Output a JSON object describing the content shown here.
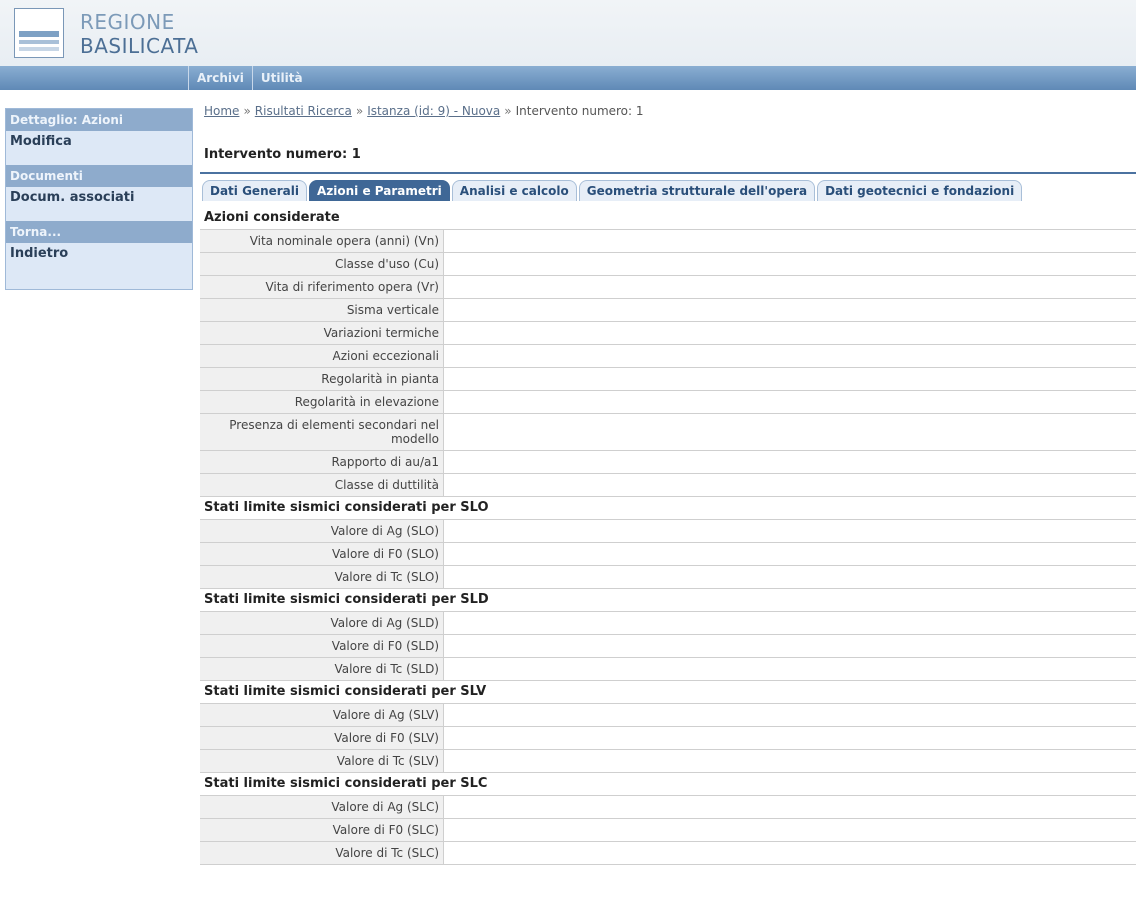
{
  "header": {
    "region_line1": "REGIONE",
    "region_line2": "BASILICATA"
  },
  "nav": {
    "items": [
      "Archivi",
      "Utilità"
    ]
  },
  "sidebar": {
    "sections": [
      {
        "title": "Dettaglio: Azioni",
        "items": [
          "Modifica"
        ]
      },
      {
        "title": "Documenti",
        "items": [
          "Docum. associati"
        ]
      },
      {
        "title": "Torna...",
        "items": [
          "Indietro"
        ]
      }
    ]
  },
  "breadcrumb": {
    "home": "Home",
    "results": "Risultati Ricerca",
    "instance": "Istanza (id: 9) - Nuova",
    "current": "Intervento numero: 1",
    "separator": "»"
  },
  "page": {
    "title": "Intervento numero: 1"
  },
  "tabs": [
    {
      "label": "Dati Generali",
      "active": false
    },
    {
      "label": "Azioni e Parametri",
      "active": true
    },
    {
      "label": "Analisi e calcolo",
      "active": false
    },
    {
      "label": "Geometria strutturale dell'opera",
      "active": false
    },
    {
      "label": "Dati geotecnici e fondazioni",
      "active": false
    }
  ],
  "azioni": {
    "title": "Azioni considerate",
    "rows": [
      "Vita nominale opera (anni) (Vn)",
      "Classe d'uso (Cu)",
      "Vita di riferimento opera (Vr)",
      "Sisma verticale",
      "Variazioni termiche",
      "Azioni eccezionali",
      "Regolarità in pianta",
      "Regolarità in elevazione",
      "Presenza di elementi secondari nel modello",
      "Rapporto di au/a1",
      "Classe di duttilità"
    ]
  },
  "slo": {
    "title": "Stati limite sismici considerati per SLO",
    "rows": [
      "Valore di Ag (SLO)",
      "Valore di F0 (SLO)",
      "Valore di Tc (SLO)"
    ]
  },
  "sld": {
    "title": "Stati limite sismici considerati per SLD",
    "rows": [
      "Valore di Ag (SLD)",
      "Valore di F0 (SLD)",
      "Valore di Tc (SLD)"
    ]
  },
  "slv": {
    "title": "Stati limite sismici considerati per SLV",
    "rows": [
      "Valore di Ag (SLV)",
      "Valore di F0 (SLV)",
      "Valore di Tc (SLV)"
    ]
  },
  "slc": {
    "title": "Stati limite sismici considerati per SLC",
    "rows": [
      "Valore di Ag (SLC)",
      "Valore di F0 (SLC)",
      "Valore di Tc (SLC)"
    ]
  }
}
